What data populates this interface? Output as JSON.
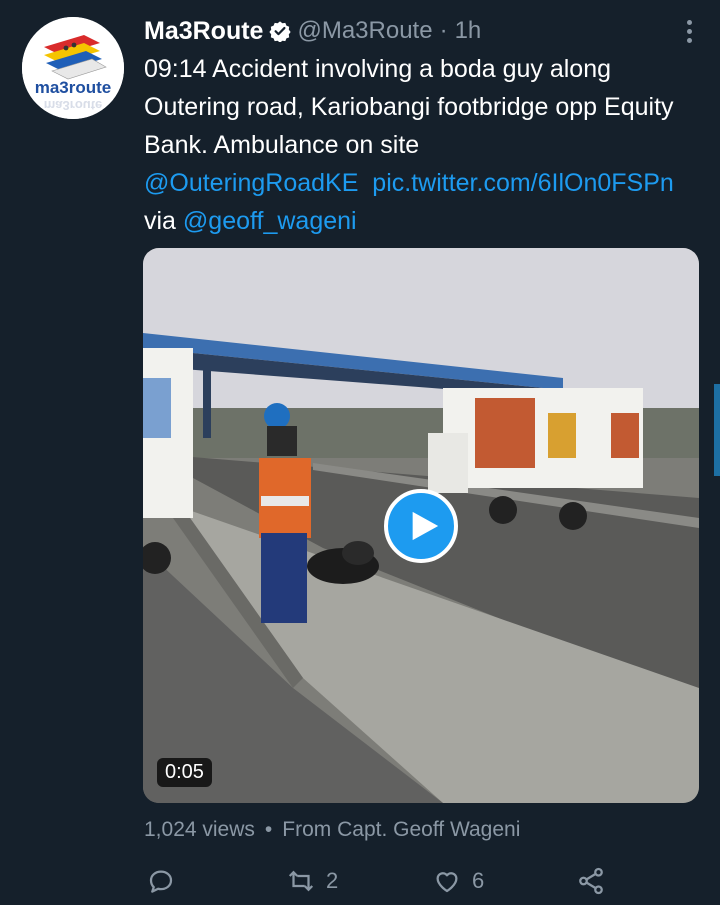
{
  "tweet": {
    "author_name": "Ma3Route",
    "handle": "@Ma3Route",
    "separator": "·",
    "time": "1h",
    "text_main": "09:14 Accident  involving a boda guy along Outering road, Kariobangi footbridge opp Equity Bank. Ambulance on site",
    "mention_1": "@OuteringRoadKE",
    "pic_link": "pic.twitter.com/6IlOn0FSPn",
    "via_label": "via",
    "mention_2": "@geoff_wageni",
    "avatar_logo_text": "ma3route"
  },
  "media": {
    "duration": "0:05",
    "play_icon": "play-icon"
  },
  "meta": {
    "views": "1,024 views",
    "dot": "•",
    "source": "From Capt. Geoff Wageni"
  },
  "actions": {
    "reply_count": "",
    "retweet_count": "2",
    "like_count": "6"
  },
  "colors": {
    "background": "#15202b",
    "accent": "#1d9bf0",
    "secondary_text": "#8b98a5"
  }
}
